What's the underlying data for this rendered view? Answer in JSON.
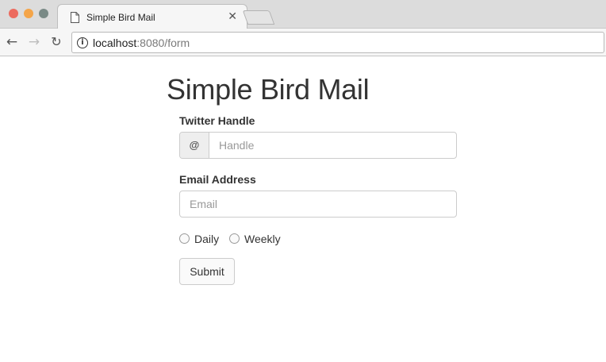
{
  "browser": {
    "tab": {
      "title": "Simple Bird Mail",
      "close_glyph": "✕",
      "icon": "document-icon"
    },
    "nav": {
      "back": "←",
      "forward": "→",
      "reload": "↻"
    },
    "address_bar": {
      "info_glyph": "i",
      "host": "localhost",
      "rest": ":8080/form"
    },
    "window_controls": {
      "close_color": "#ec6b5f",
      "minimize_color": "#f4a549",
      "maximize_color": "#7a8a86"
    }
  },
  "form": {
    "title": "Simple Bird Mail",
    "twitter": {
      "label": "Twitter Handle",
      "prefix": "@",
      "placeholder": "Handle",
      "value": ""
    },
    "email": {
      "label": "Email Address",
      "placeholder": "Email",
      "value": ""
    },
    "frequency": {
      "options": [
        {
          "label": "Daily",
          "checked": false
        },
        {
          "label": "Weekly",
          "checked": false
        }
      ]
    },
    "submit_label": "Submit"
  }
}
